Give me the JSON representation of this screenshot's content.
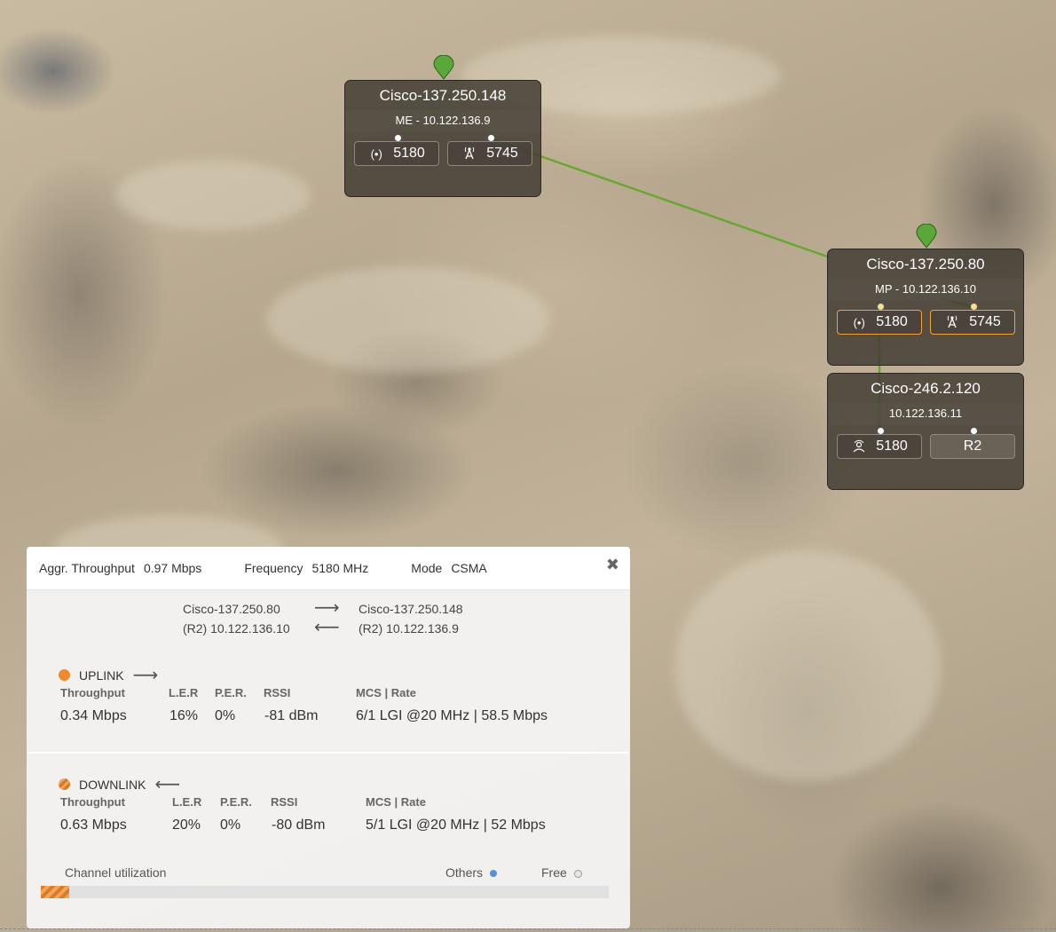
{
  "nodes": {
    "node1": {
      "name": "Cisco-137.250.148",
      "sub": "ME - 10.122.136.9",
      "ports": [
        {
          "icon": "radio-waves-icon",
          "glyph": "(•)",
          "label": "5180"
        },
        {
          "icon": "antenna-icon",
          "glyph": "🗼",
          "label": "5745"
        }
      ]
    },
    "node2": {
      "name": "Cisco-137.250.80",
      "sub": "MP - 10.122.136.10",
      "ports": [
        {
          "icon": "radio-waves-icon",
          "glyph": "(•)",
          "label": "5180"
        },
        {
          "icon": "antenna-icon",
          "glyph": "🗼",
          "label": "5745"
        }
      ]
    },
    "node3": {
      "name": "Cisco-246.2.120",
      "sub": "10.122.136.11",
      "ports": [
        {
          "icon": "user-radio-icon",
          "glyph": "☊",
          "label": "5180"
        },
        {
          "icon": "",
          "glyph": "",
          "label": "R2"
        }
      ]
    }
  },
  "panel": {
    "aggr_label": "Aggr. Throughput",
    "aggr_value": "0.97 Mbps",
    "freq_label": "Frequency",
    "freq_value": "5180 MHz",
    "mode_label": "Mode",
    "mode_value": "CSMA",
    "close": "✖",
    "link": {
      "left_name": "Cisco-137.250.80",
      "left_ip": "(R2)  10.122.136.10",
      "right_name": "Cisco-137.250.148",
      "right_ip": "(R2)  10.122.136.9",
      "right_arrow": "⟶",
      "left_arrow": "⟵"
    },
    "uplink": {
      "title": "UPLINK",
      "arrow": "⟶",
      "color": "#f08a2a",
      "headers": {
        "throughput": "Throughput",
        "ler": "L.E.R",
        "per": "P.E.R.",
        "rssi": "RSSI",
        "mcs": "MCS | Rate"
      },
      "values": {
        "throughput": "0.34 Mbps",
        "ler": "16%",
        "per": "0%",
        "rssi": "-81 dBm",
        "mcs": "6/1 LGI @20 MHz | 58.5 Mbps"
      }
    },
    "downlink": {
      "title": "DOWNLINK",
      "arrow": "⟵",
      "color": "#d9772a",
      "headers": {
        "throughput": "Throughput",
        "ler": "L.E.R",
        "per": "P.E.R.",
        "rssi": "RSSI",
        "mcs": "MCS | Rate"
      },
      "values": {
        "throughput": "0.63 Mbps",
        "ler": "20%",
        "per": "0%",
        "rssi": "-80 dBm",
        "mcs": "5/1 LGI @20 MHz | 52 Mbps"
      }
    },
    "channel": {
      "label": "Channel utilization",
      "others_label": "Others",
      "free_label": "Free",
      "others_color": "#5a8fd0",
      "utilization_fraction": 0.05
    }
  },
  "colors": {
    "link": "#6aa632",
    "pin": "#5aa83a",
    "selected_port": "#f2a33a"
  }
}
